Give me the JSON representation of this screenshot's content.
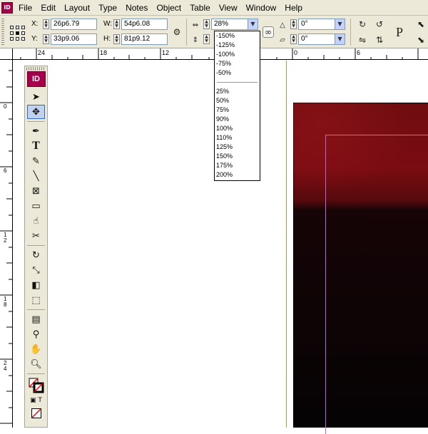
{
  "app": {
    "icon_label": "ID"
  },
  "menu": [
    "File",
    "Edit",
    "Layout",
    "Type",
    "Notes",
    "Object",
    "Table",
    "View",
    "Window",
    "Help"
  ],
  "control_panel": {
    "x_label": "X:",
    "x_value": "26p6.79",
    "y_label": "Y:",
    "y_value": "33p9.06",
    "w_label": "W:",
    "w_value": "54p6.08",
    "h_label": "H:",
    "h_value": "81p9.12",
    "scale_x_value": "28%",
    "rotate_value": "0°",
    "shear_value": "0°",
    "p_label": "P"
  },
  "zoom_dropdown": {
    "negative_options": [
      "-150%",
      "-125%",
      "-100%",
      "-75%",
      "-50%"
    ],
    "positive_options": [
      "25%",
      "50%",
      "75%",
      "90%",
      "100%",
      "110%",
      "125%",
      "150%",
      "175%",
      "200%"
    ]
  },
  "rulers": {
    "horizontal": [
      "24",
      "18",
      "12",
      "6",
      "0",
      "6"
    ],
    "vertical": [
      [
        "0"
      ],
      [
        "6"
      ],
      [
        "1",
        "2"
      ],
      [
        "1",
        "8"
      ],
      [
        "2",
        "4"
      ]
    ]
  },
  "tools": {
    "logo": "ID",
    "items": [
      "selection-tool",
      "direct-selection-tool",
      "pen-tool",
      "type-tool",
      "pencil-tool",
      "line-tool",
      "rectangle-frame-tool",
      "rectangle-tool",
      "button-tool",
      "scissors-tool",
      "rotate-tool",
      "scale-tool",
      "gradient-tool",
      "free-transform-tool",
      "note-tool",
      "eyedropper-tool",
      "hand-tool",
      "zoom-tool"
    ]
  },
  "colors": {
    "accent": "#a6004b",
    "photo_red": "#7a0c12",
    "margin_guide": "#b26bd6",
    "page_edge": "#c8922e"
  }
}
